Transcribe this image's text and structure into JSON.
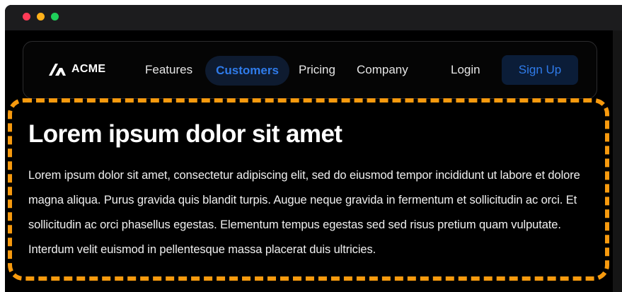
{
  "window": {
    "controls": [
      "close",
      "minimize",
      "maximize"
    ],
    "colors": {
      "close": "#ff3b57",
      "minimize": "#ffb11a",
      "maximize": "#1fcf5a"
    }
  },
  "navbar": {
    "logo_icon": "acme-logo-icon",
    "logo_text": "ACME",
    "links": {
      "features": "Features",
      "customers": "Customers",
      "pricing": "Pricing",
      "company": "Company"
    },
    "active_link": "Customers",
    "login_label": "Login",
    "signup_label": "Sign Up",
    "accent_color": "#2f7bea"
  },
  "hero": {
    "title": "Lorem ipsum dolor sit amet",
    "body": "Lorem ipsum dolor sit amet, consectetur adipiscing elit, sed do eiusmod tempor incididunt ut labore et dolore magna aliqua. Purus gravida quis blandit turpis. Augue neque gravida in fermentum et sollicitudin ac orci. Et sollicitudin ac orci phasellus egestas. Elementum tempus egestas sed sed risus pretium quam vulputate. Interdum velit euismod in pellentesque massa placerat duis ultricies."
  },
  "highlight_color": "#f79a0e"
}
